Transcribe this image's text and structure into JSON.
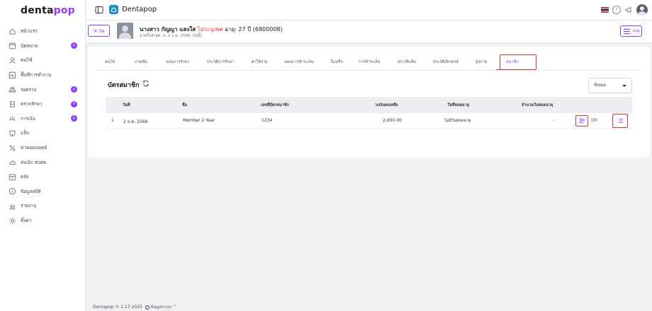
{
  "app": {
    "logo_main": "denta",
    "logo_accent": "pop",
    "brand_name": "Dentapop"
  },
  "sidebar": {
    "items": [
      {
        "label": "หน้าแรก",
        "icon": "home-icon",
        "badge": ""
      },
      {
        "label": "นัดหมาย",
        "icon": "calendar-icon",
        "badge": "0"
      },
      {
        "label": "คนไข้",
        "icon": "user-icon",
        "badge": ""
      },
      {
        "label": "พื้นที่การทำงาน",
        "icon": "workspace-icon",
        "badge": ""
      },
      {
        "label": "รอตรวจ",
        "icon": "waiting-icon",
        "badge": "0"
      },
      {
        "label": "ตรวจรักษา",
        "icon": "treatment-icon",
        "badge": "0"
      },
      {
        "label": "การเงิน",
        "icon": "finance-icon",
        "badge": "0"
      },
      {
        "label": "แล็บ",
        "icon": "lab-icon",
        "badge": ""
      },
      {
        "label": "ค่าคอมแพทย์",
        "icon": "percent-icon",
        "badge": ""
      },
      {
        "label": "ส่งเบิก สปสช.",
        "icon": "cloud-icon",
        "badge": ""
      },
      {
        "label": "คลัง",
        "icon": "inventory-icon",
        "badge": ""
      },
      {
        "label": "ข้อมูลสถิติ",
        "icon": "info-icon",
        "badge": ""
      },
      {
        "label": "รายงาน",
        "icon": "report-icon",
        "badge": ""
      },
      {
        "label": "ตั้งค่า",
        "icon": "settings-icon",
        "badge": ""
      }
    ]
  },
  "patient": {
    "back_label": "ปิด",
    "name": "นางสาว กัญญา แสงใส",
    "gender": "ไม่ระบุเพศ",
    "age": "อายุ: 27 ปี",
    "hn": "(6800008)",
    "last_visit": "มาครั้งล่าสุด: อ. 2 ธ.ค. 2568 (วันนี้)",
    "menu_label": "เมนู"
  },
  "tabs": [
    "คนไข้",
    "ภาพฟัน",
    "แผนการรักษา",
    "ประวัติการรักษา",
    "ค่าใช้จ่าย",
    "แผนการชำระเงิน",
    "ใบเสร็จ",
    "การชำระเงิน",
    "ประวัติแล็บ",
    "ประวัติเอ็กซเรย์",
    "รูปภาพ",
    "สมาชิก"
  ],
  "active_tab": "สมาชิก",
  "membership": {
    "title": "บัตรสมาชิก",
    "filter_value": "ทั้งหมด",
    "columns": [
      "วันที่",
      "ชื่อ",
      "เลขที่บัตรสมาชิก",
      "วงเงินคงเหลือ",
      "วันที่หมดอายุ",
      "จำนวนวันหมดอายุ"
    ],
    "rows": [
      {
        "index": "1",
        "date": "2 ธ.ค. 2568",
        "name": "Member 2 Year",
        "card_no": "1234",
        "balance": "2,000.00",
        "expiry": "ไม่มีวันหมดอายุ",
        "days_left": "-",
        "count": "(0)"
      }
    ]
  },
  "footer": {
    "copyright": "Dentapop © 1.17 2025",
    "info": "ข้อมูลระบบ"
  },
  "colors": {
    "accent": "#8b3dff",
    "highlight": "#e0303a",
    "gender": "#e0303a"
  }
}
